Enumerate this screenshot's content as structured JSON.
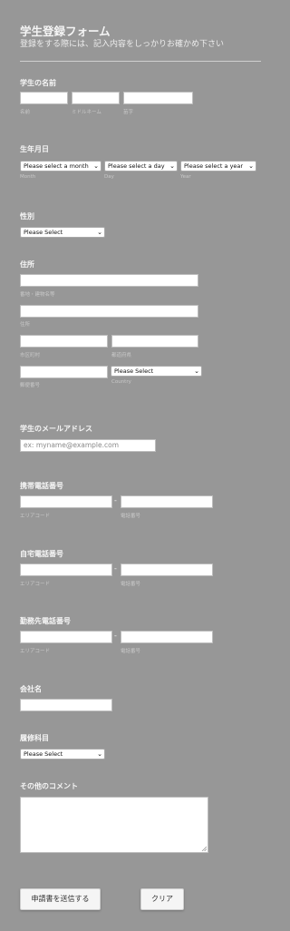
{
  "header": {
    "title": "学生登録フォーム",
    "subtitle": "登録をする際には、記入内容をしっかりお確かめ下さい"
  },
  "name_section": {
    "label": "学生の名前",
    "first_sub": "名前",
    "middle_sub": "ミドルネーム",
    "last_sub": "苗字"
  },
  "birth_section": {
    "label": "生年月日",
    "month_value": "Please select a month",
    "day_value": "Please select a day",
    "year_value": "Please select a year",
    "month_sub": "Month",
    "day_sub": "Day",
    "year_sub": "Year"
  },
  "gender_section": {
    "label": "性別",
    "value": "Please Select"
  },
  "address_section": {
    "label": "住所",
    "street_sub": "番地・建物名等",
    "street2_sub": "住所",
    "city_sub": "市区町村",
    "state_sub": "都道府県",
    "zip_sub": "郵便番号",
    "country_value": "Please Select",
    "country_sub": "Country"
  },
  "email_section": {
    "label": "学生のメールアドレス",
    "placeholder": "ex: myname@example.com"
  },
  "mobile_section": {
    "label": "携帯電話番号",
    "dash": "-",
    "area_sub": "エリアコード",
    "number_sub": "電話番号"
  },
  "home_phone_section": {
    "label": "自宅電話番号",
    "dash": "-",
    "area_sub": "エリアコード",
    "number_sub": "電話番号"
  },
  "work_phone_section": {
    "label": "勤務先電話番号",
    "dash": "-",
    "area_sub": "エリアコード",
    "number_sub": "電話番号"
  },
  "company_section": {
    "label": "会社名"
  },
  "course_section": {
    "label": "履修科目",
    "value": "Please Select"
  },
  "comment_section": {
    "label": "その他のコメント"
  },
  "buttons": {
    "submit": "申請書を送信する",
    "clear": "クリア"
  }
}
